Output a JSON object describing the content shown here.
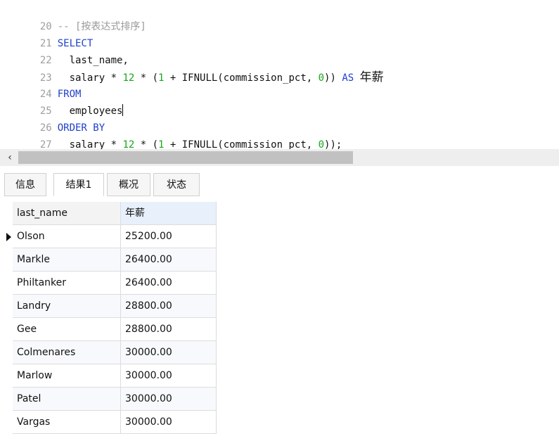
{
  "editor": {
    "lines": [
      {
        "num": "20",
        "comment": "-- [按表达式排序]"
      },
      {
        "num": "21",
        "kw": "SELECT"
      },
      {
        "num": "22",
        "text": "  last_name,"
      },
      {
        "num": "23",
        "p1": "  salary * ",
        "n1": "12",
        "p2": " * (",
        "n2": "1",
        "p3": " + IFNULL(commission_pct, ",
        "n3": "0",
        "p4": ")) ",
        "kw": "AS",
        "alias": "年薪"
      },
      {
        "num": "24",
        "kw": "FROM"
      },
      {
        "num": "25",
        "text": "  employees"
      },
      {
        "num": "26",
        "kw": "ORDER BY"
      },
      {
        "num": "27",
        "p1": "  salary * ",
        "n1": "12",
        "p2": " * (",
        "n2": "1",
        "p3": " + IFNULL(commission_pct, ",
        "n3": "0",
        "p4": "));"
      }
    ]
  },
  "tabs": [
    {
      "label": "信息"
    },
    {
      "label": "结果1"
    },
    {
      "label": "概况"
    },
    {
      "label": "状态"
    }
  ],
  "grid": {
    "columns": [
      "last_name",
      "年薪"
    ],
    "rows": [
      [
        "Olson",
        "25200.00"
      ],
      [
        "Markle",
        "26400.00"
      ],
      [
        "Philtanker",
        "26400.00"
      ],
      [
        "Landry",
        "28800.00"
      ],
      [
        "Gee",
        "28800.00"
      ],
      [
        "Colmenares",
        "30000.00"
      ],
      [
        "Marlow",
        "30000.00"
      ],
      [
        "Patel",
        "30000.00"
      ],
      [
        "Vargas",
        "30000.00"
      ]
    ]
  },
  "colors": {
    "keyword": "#1f3fcc",
    "number": "#16a716",
    "comment": "#9a9a9a"
  },
  "icons": {
    "scroll_left": "chevron-left-icon",
    "current_row": "current-row-triangle-icon"
  }
}
